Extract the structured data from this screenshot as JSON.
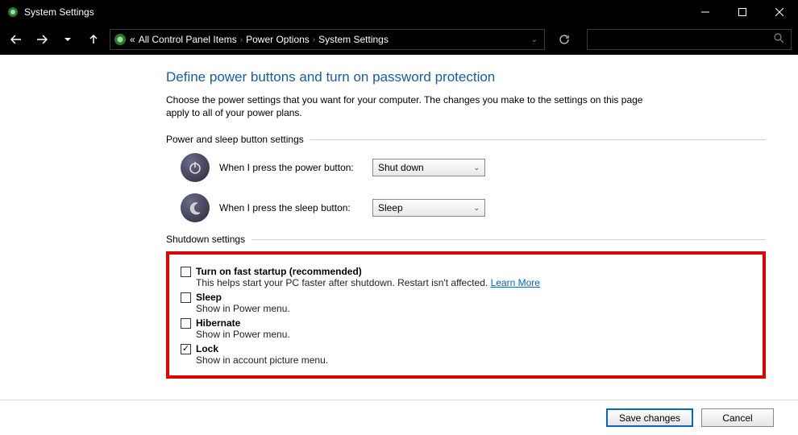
{
  "window": {
    "title": "System Settings"
  },
  "breadcrumb": {
    "prefix": "«",
    "items": [
      "All Control Panel Items",
      "Power Options",
      "System Settings"
    ]
  },
  "page": {
    "heading": "Define power buttons and turn on password protection",
    "description": "Choose the power settings that you want for your computer. The changes you make to the settings on this page apply to all of your power plans."
  },
  "section_buttons": {
    "title": "Power and sleep button settings",
    "power": {
      "label": "When I press the power button:",
      "value": "Shut down"
    },
    "sleep": {
      "label": "When I press the sleep button:",
      "value": "Sleep"
    }
  },
  "section_shutdown": {
    "title": "Shutdown settings",
    "items": [
      {
        "checked": false,
        "label": "Turn on fast startup (recommended)",
        "desc": "This helps start your PC faster after shutdown. Restart isn't affected.",
        "link": "Learn More"
      },
      {
        "checked": false,
        "label": "Sleep",
        "desc": "Show in Power menu."
      },
      {
        "checked": false,
        "label": "Hibernate",
        "desc": "Show in Power menu."
      },
      {
        "checked": true,
        "label": "Lock",
        "desc": "Show in account picture menu."
      }
    ]
  },
  "footer": {
    "save": "Save changes",
    "cancel": "Cancel"
  }
}
